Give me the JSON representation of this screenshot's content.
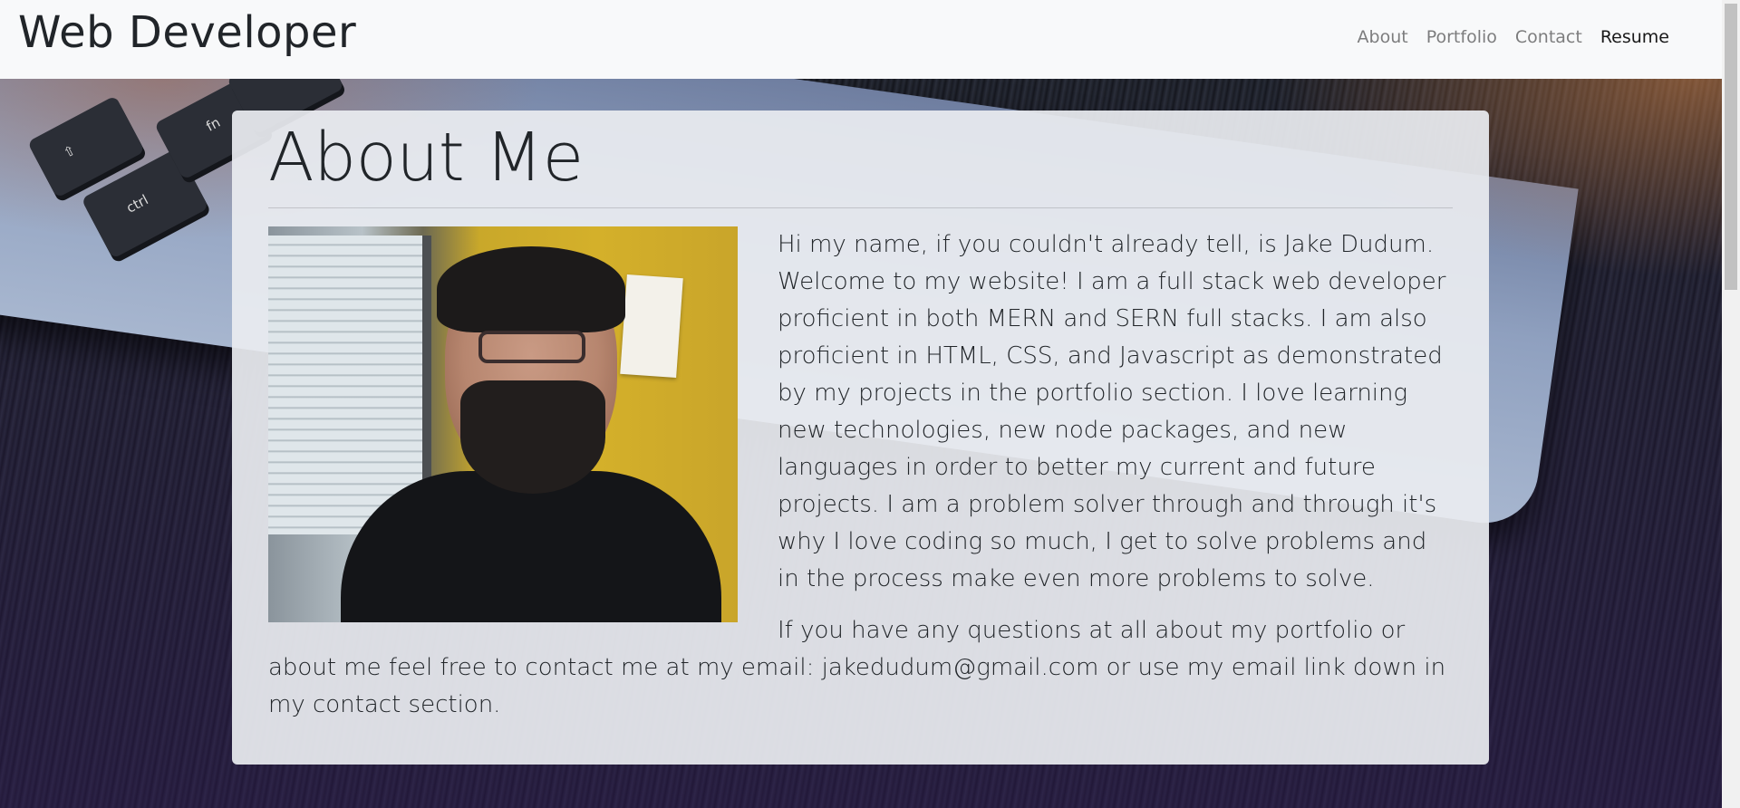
{
  "navbar": {
    "brand": "Web Developer",
    "links": [
      {
        "label": "About",
        "active": false
      },
      {
        "label": "Portfolio",
        "active": false
      },
      {
        "label": "Contact",
        "active": false
      },
      {
        "label": "Resume",
        "active": true
      }
    ]
  },
  "background": {
    "keys": [
      "ctrl",
      "fn"
    ]
  },
  "about": {
    "heading": "About Me",
    "photo_alt": "Photo of Jake Dudum",
    "paragraphs": [
      "Hi my name, if you couldn't already tell, is Jake Dudum. Welcome to my website! I am a full stack web developer proficient in both MERN and SERN full stacks. I am also proficient in HTML, CSS, and Javascript as demonstrated by my projects in the portfolio section. I love learning new technologies, new node packages, and new languages in order to better my current and future projects. I am a problem solver through and through it's why I love coding so much, I get to solve problems and in the process make even more problems to solve.",
      "If you have any questions at all about my portfolio or about me feel free to contact me at my email: jakedudum@gmail.com or use my email link down in my contact section."
    ]
  },
  "colors": {
    "navbar_bg": "#f8f9fa",
    "card_bg": "#e9ecf0",
    "text": "#212529"
  }
}
